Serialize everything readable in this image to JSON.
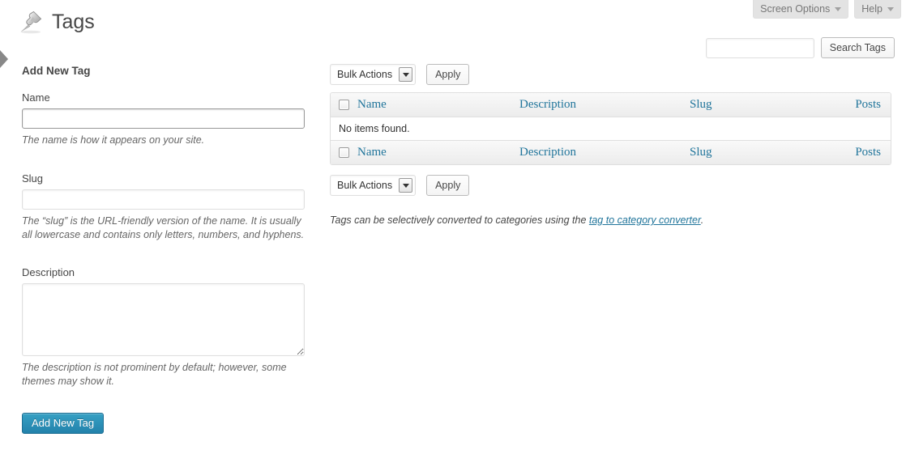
{
  "screen_meta": {
    "screen_options_label": "Screen Options",
    "help_label": "Help"
  },
  "header": {
    "title": "Tags",
    "icon": "pushpin-icon"
  },
  "search": {
    "value": "",
    "placeholder": "",
    "button_label": "Search Tags"
  },
  "form": {
    "heading": "Add New Tag",
    "name": {
      "label": "Name",
      "value": "",
      "help": "The name is how it appears on your site."
    },
    "slug": {
      "label": "Slug",
      "value": "",
      "help": "The “slug” is the URL-friendly version of the name. It is usually all lowercase and contains only letters, numbers, and hyphens."
    },
    "description": {
      "label": "Description",
      "value": "",
      "help": "The description is not prominent by default; however, some themes may show it."
    },
    "submit_label": "Add New Tag"
  },
  "tablenav": {
    "bulk_actions_label": "Bulk Actions",
    "apply_label": "Apply"
  },
  "table": {
    "columns": [
      {
        "key": "name",
        "label": "Name"
      },
      {
        "key": "description",
        "label": "Description"
      },
      {
        "key": "slug",
        "label": "Slug"
      },
      {
        "key": "posts",
        "label": "Posts"
      }
    ],
    "empty_message": "No items found.",
    "rows": []
  },
  "footer_note": {
    "text_before": "Tags can be selectively converted to categories using the ",
    "link_text": "tag to category converter",
    "text_after": "."
  },
  "colors": {
    "accent_link": "#21759b",
    "primary_button": "#2382ab",
    "body_text": "#464646",
    "border": "#dfdfdf"
  }
}
